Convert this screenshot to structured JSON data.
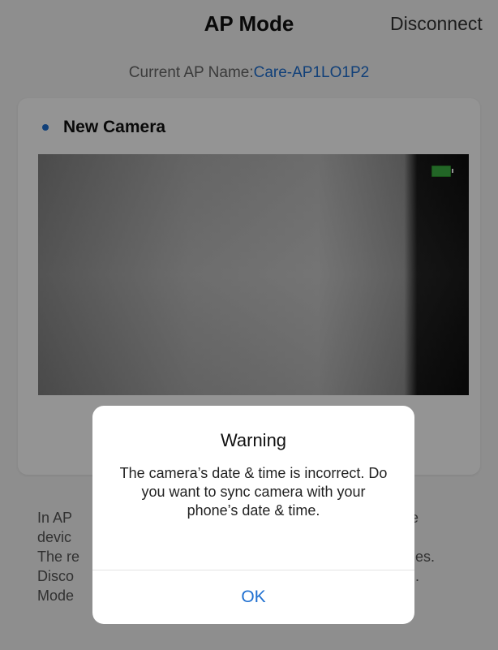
{
  "header": {
    "title": "AP Mode",
    "action_label": "Disconnect"
  },
  "ap_info": {
    "label": "Current AP Name:",
    "value": "Care-AP1LO1P2"
  },
  "camera": {
    "name": "New Camera"
  },
  "info_text": {
    "line1": "In AP",
    "line1_end": "ne",
    "line2": "devic",
    "line3": "The re",
    "line3_end": "es.",
    "line4": "Disco",
    "line4_end": ".",
    "line5": "Mode"
  },
  "dialog": {
    "title": "Warning",
    "message": "The camera’s date & time is incorrect. Do you want to sync camera with your phone’s date & time.",
    "ok_label": "OK"
  },
  "colors": {
    "accent": "#1e6fd0",
    "battery": "#3cb043"
  }
}
